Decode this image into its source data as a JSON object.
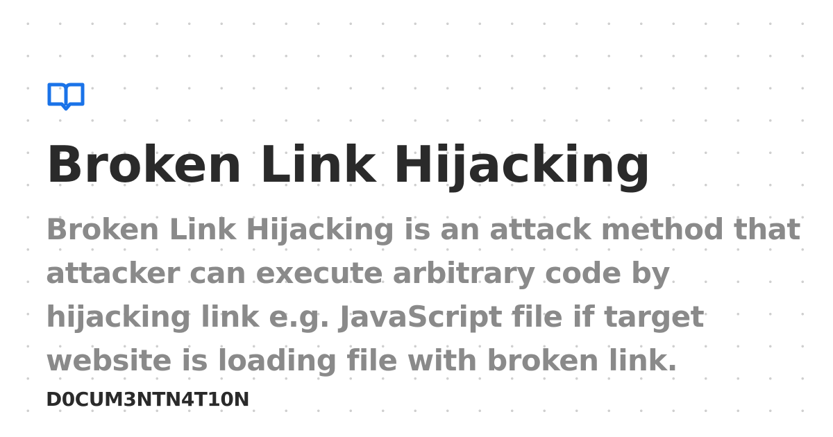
{
  "brand": {
    "icon": "open-book-icon",
    "accent_color": "#1a73e8"
  },
  "page": {
    "title": "Broken Link Hijacking",
    "description": "Broken Link Hijacking is an attack method that attacker can execute arbitrary code by hijacking link e.g. JavaScript file if target website is loading file with broken link.",
    "site_name": "D0CUM3NTN4T10N"
  },
  "colors": {
    "background": "#ffffff",
    "title": "#2a2a2a",
    "description": "#8a8a8a",
    "pattern_dots": "#cfcfcf"
  }
}
